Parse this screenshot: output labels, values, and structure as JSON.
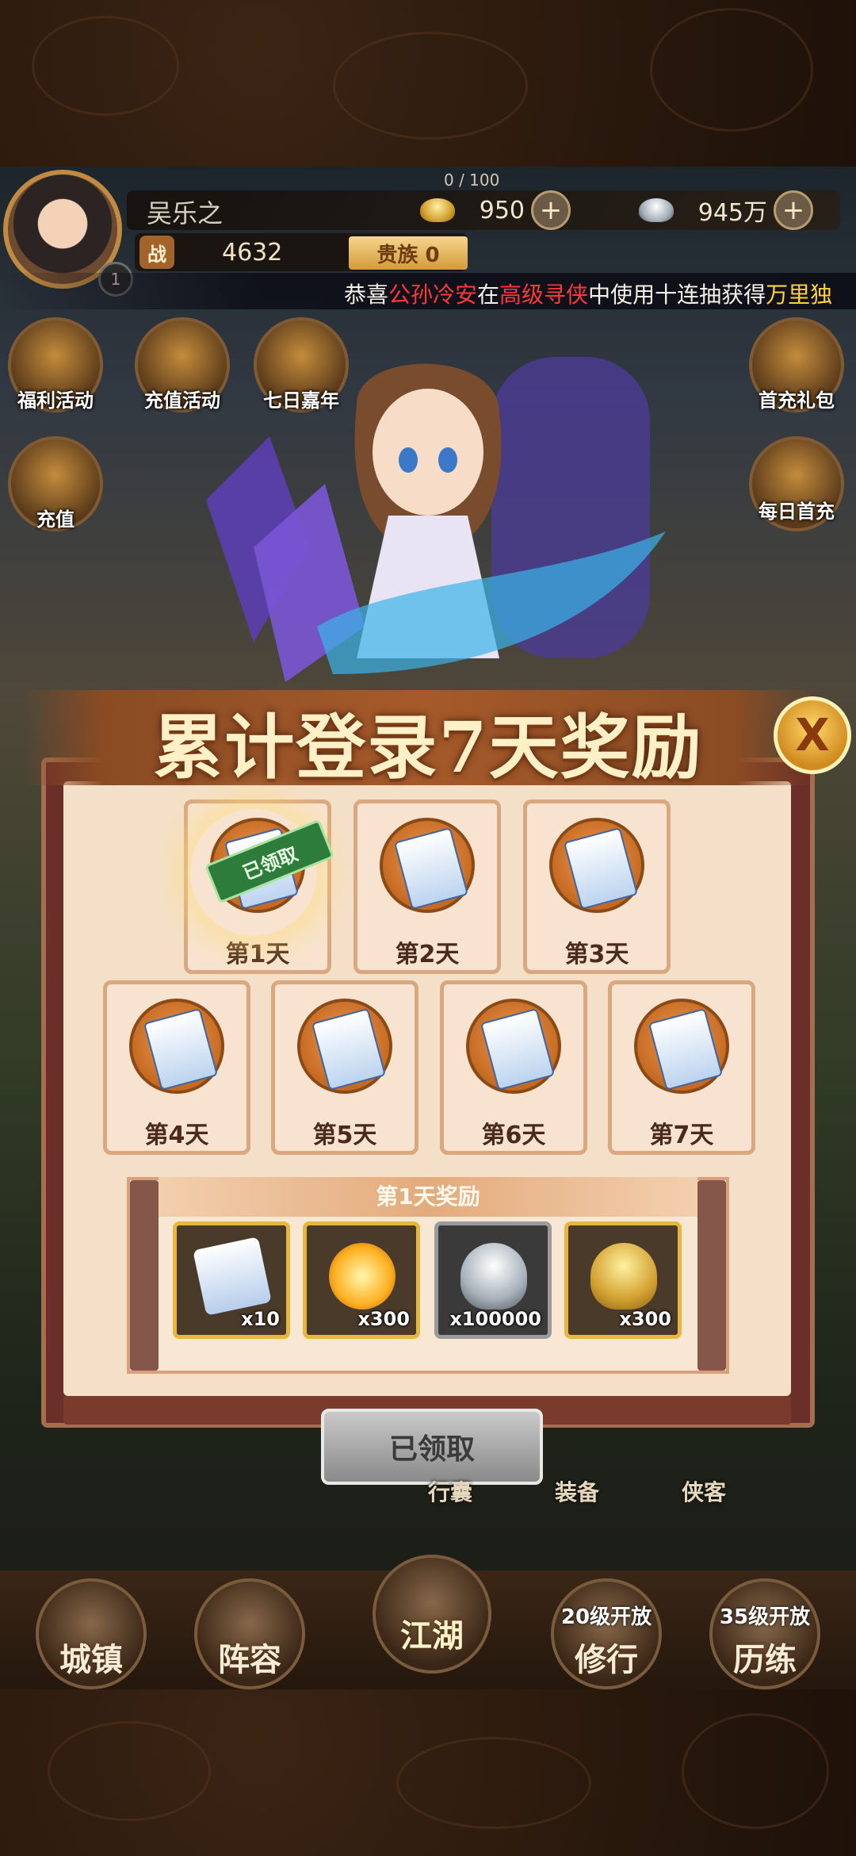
{
  "player": {
    "name": "吴乐之",
    "level": "1",
    "exp_text": "0 / 100",
    "power_label": "战",
    "power_value": "4632",
    "noble_label": "贵族 0"
  },
  "currencies": {
    "gold_value": "950",
    "silver_value": "945万",
    "plus": "+"
  },
  "marquee": {
    "prefix": "恭喜",
    "player": "公孙冷安",
    "mid1": "在",
    "activity": "高级寻侠",
    "mid2": "中使用十连抽获得",
    "reward": "万里独"
  },
  "side_left": [
    {
      "label": "福利活动"
    },
    {
      "label": "充值活动"
    },
    {
      "label": "七日嘉年"
    },
    {
      "label": "充值"
    }
  ],
  "side_right": [
    {
      "label": "首充礼包"
    },
    {
      "label": "每日首充"
    }
  ],
  "dialog": {
    "title": "累计登录7天奖励",
    "close_label": "X",
    "claimed_stamp": "已领取",
    "days": [
      {
        "label": "第1天",
        "claimed": true
      },
      {
        "label": "第2天",
        "claimed": false
      },
      {
        "label": "第3天",
        "claimed": false
      },
      {
        "label": "第4天",
        "claimed": false
      },
      {
        "label": "第5天",
        "claimed": false
      },
      {
        "label": "第6天",
        "claimed": false
      },
      {
        "label": "第7天",
        "claimed": false
      }
    ],
    "reward_header": "第1天奖励",
    "rewards": [
      {
        "name": "scroll",
        "qty": "x10"
      },
      {
        "name": "fire-orb",
        "qty": "x300"
      },
      {
        "name": "silver-ingot",
        "qty": "x100000"
      },
      {
        "name": "gold-ingot",
        "qty": "x300"
      }
    ],
    "claim_button": "已领取"
  },
  "under_labels": {
    "bag": "行囊",
    "equip": "装备",
    "hero": "侠客"
  },
  "bottom_nav": [
    {
      "label": "城镇",
      "lock": ""
    },
    {
      "label": "阵容",
      "lock": ""
    },
    {
      "label": "江湖",
      "lock": ""
    },
    {
      "label": "修行",
      "lock": "20级开放"
    },
    {
      "label": "历练",
      "lock": "35级开放"
    }
  ]
}
